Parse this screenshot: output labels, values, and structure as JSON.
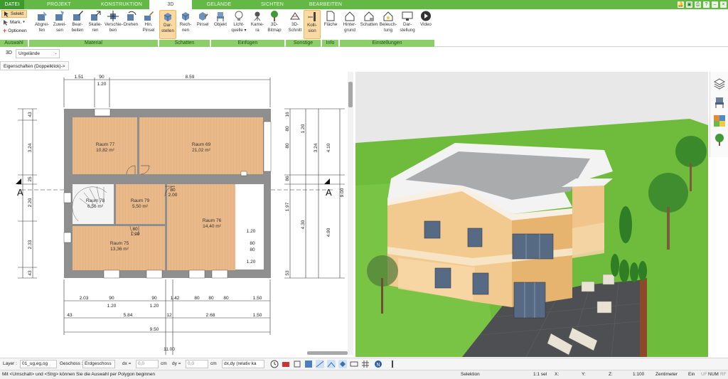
{
  "tabs": [
    {
      "label": "DATEI"
    },
    {
      "label": "PROJEKT"
    },
    {
      "label": "KONSTRUKTION"
    },
    {
      "label": "3D"
    },
    {
      "label": "GELÄNDE"
    },
    {
      "label": "SICHTEN"
    },
    {
      "label": "BEARBEITEN"
    }
  ],
  "window_controls": [
    "bell-icon",
    "save-icon",
    "print-icon",
    "help-icon",
    "minimize-icon",
    "close-icon"
  ],
  "ribbon": {
    "auswahl": {
      "label": "Auswahl",
      "select": "Selekt",
      "mark": "Mark.",
      "options": "Optionen"
    },
    "material": {
      "label": "Material",
      "buttons": [
        "Abgrei-\nfen",
        "Zuwei-\nsen",
        "Bear-\nbeiten",
        "Skalie-\nren",
        "Verschie-\nben",
        "Drehen",
        "Hin.\nPinsel"
      ]
    },
    "schatten": {
      "label": "Schatten",
      "buttons": [
        "Dar-\nstellen",
        "Rech-\nnen",
        "Pinsel"
      ]
    },
    "einfuegen": {
      "label": "Einfügen",
      "buttons": [
        "Objekt",
        "Licht-\nquelle ▾",
        "Kame-\nra",
        "3D-\nBitmap"
      ]
    },
    "sonstige": {
      "label": "Sonstige",
      "buttons": [
        "3D-\nSchnitt",
        "Kolli-\nsion"
      ]
    },
    "info": {
      "label": "Info",
      "buttons": [
        "Fläche"
      ]
    },
    "einstellungen": {
      "label": "Einstellungen",
      "buttons": [
        "Hinter-\ngrund",
        "Schatten",
        "Beleuch-\ntung",
        "Dar-\nstellung",
        "Video"
      ]
    }
  },
  "subbar": {
    "view": "3D",
    "level": "Urgelände"
  },
  "properties_label": "Eigenschaften (Doppelklick)->",
  "plan": {
    "rooms": [
      {
        "name": "Raum 77",
        "area": "10,82 m²"
      },
      {
        "name": "Raum 69",
        "area": "21,02 m²"
      },
      {
        "name": "Raum 78",
        "area": "6,56 m²"
      },
      {
        "name": "Raum 79",
        "area": "5,50 m²"
      },
      {
        "name": "Raum 76",
        "area": "14,40 m²"
      },
      {
        "name": "Raum 75",
        "area": "13,36 m²"
      }
    ],
    "section_mark": "A",
    "dims_top": [
      "1.51",
      "90",
      "1.20",
      "8.59"
    ],
    "dims_bottom_1": [
      "2.03",
      "90",
      "1.20",
      "90",
      "1.20",
      "1.42",
      "80",
      "80",
      "80",
      "1.50"
    ],
    "dims_bottom_2": [
      "43",
      "5.84",
      "12",
      "2.68",
      "1.50"
    ],
    "dims_bottom_3": [
      "9.50"
    ],
    "dims_left": [
      "43",
      "3.24",
      "25",
      "2.20",
      "2.33",
      "43"
    ],
    "dims_right_a": [
      "16",
      "80",
      "80",
      "86",
      "1.97",
      "4.30",
      "53"
    ],
    "dims_right_b": [
      "1.20",
      "3.24",
      "4.10",
      "4.90",
      "9.00"
    ],
    "dims_interior": [
      "80",
      "2.00",
      "80",
      "1.20",
      "1.20",
      "80",
      "80",
      "1.20"
    ],
    "dim_footer": "11.00"
  },
  "side_tools": [
    "layers-icon",
    "chair-icon",
    "palette-icon",
    "tree-icon"
  ],
  "bottombar": {
    "layer_label": "Layer :",
    "layer_value": "01_ug,eg,og",
    "geschoss_label": "Geschoss :",
    "geschoss_value": "Erdgeschoss",
    "dx_label": "dx =",
    "dx_value": "0,0",
    "dy_label": "dy =",
    "dy_value": "0,0",
    "unit": "cm",
    "mode_value": "dx,dy (relativ ka"
  },
  "statusbar": {
    "hint": "Mit <Umschalt> und <Strg> können Sie die Auswahl per Polygon beginnen",
    "mode": "Selektion",
    "scale_sel": "1:1 sel",
    "x_label": "X:",
    "y_label": "Y:",
    "z_label": "Z:",
    "scale": "1:100",
    "unit": "Zentimeter",
    "ein": "Ein",
    "uf": "UF",
    "num": "NUM",
    "rf": "RF"
  },
  "colors": {
    "tab_green": "#64b845",
    "group_label_green": "#8ccf6a",
    "active_orange": "#fbd9a2",
    "wall_gray": "#8f8f8f",
    "floor_wood": "#eab98a",
    "grass": "#6fbc3d"
  }
}
